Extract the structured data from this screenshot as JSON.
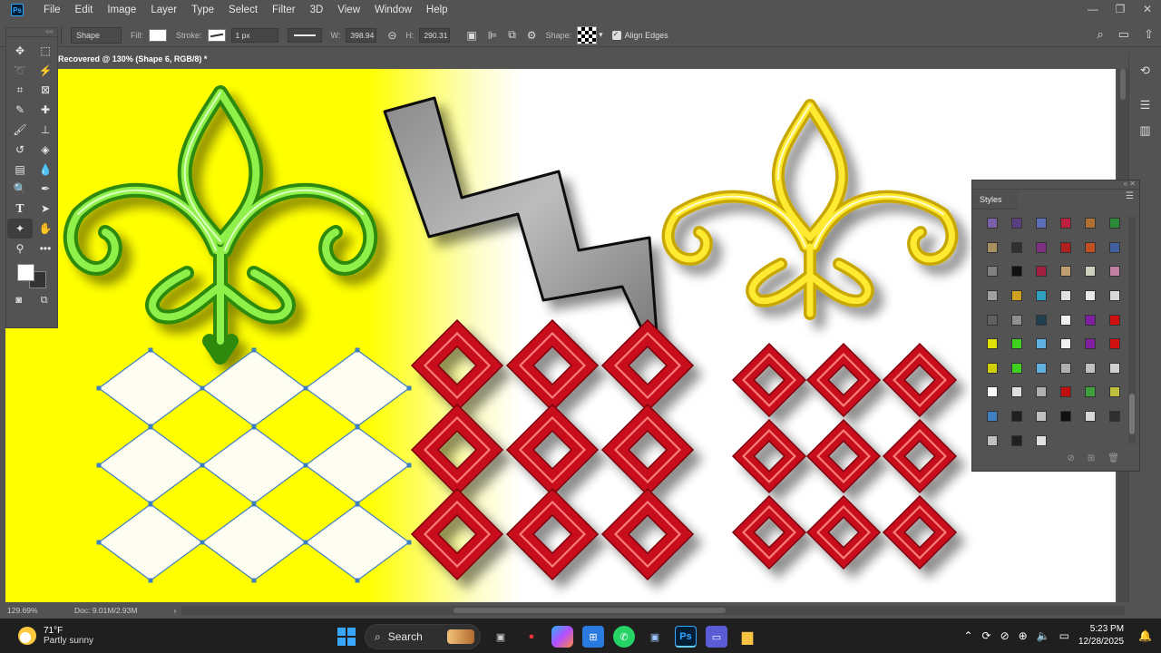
{
  "app": {
    "logo": "Ps"
  },
  "menu": [
    "File",
    "Edit",
    "Image",
    "Layer",
    "Type",
    "Select",
    "Filter",
    "3D",
    "View",
    "Window",
    "Help"
  ],
  "options_bar": {
    "tool_mode": "Shape",
    "fill_label": "Fill:",
    "stroke_label": "Stroke:",
    "stroke_width": "1 px",
    "w_label": "W:",
    "w_value": "398.94",
    "h_label": "H:",
    "h_value": "290.31",
    "shape_label": "Shape:",
    "align_edges": "Align Edges"
  },
  "document": {
    "tab_title": "Recovered @ 130% (Shape 6, RGB/8) *"
  },
  "styles_panel": {
    "title": "Styles",
    "swatches": [
      "#7b5fa8",
      "#5a3f80",
      "#5b6fb8",
      "#c02040",
      "#b07030",
      "#2a8a3a",
      "#a89060",
      "#303030",
      "#803080",
      "#b02020",
      "#c05020",
      "#4060a0",
      "#808080",
      "#101010",
      "#a02040",
      "#c0a070",
      "#d0d0c0",
      "#c080a0",
      "#a0a0a0",
      "#d0a020",
      "#30a0c0",
      "#e0e0e0",
      "#e8e8e8",
      "#d8d8d8",
      "#606060",
      "#909090",
      "#204050",
      "#f0f0f0",
      "#8020a0",
      "#d01010",
      "#e0e000",
      "#40d020",
      "#60b0e0",
      "#f0f0f0",
      "#8020a0",
      "#d01010",
      "#d0d000",
      "#40d020",
      "#60b0e0",
      "#b0b0b0",
      "#c0c0c0",
      "#d0d0d0",
      "#f8f8f8",
      "#e0e0e0",
      "#b0b0b0",
      "#c01010",
      "#40a040",
      "#c0c040",
      "#4080c0",
      "#202020",
      "#c0c0c0",
      "#101010",
      "#d8d8d8",
      "#303030",
      "#c0c0c0",
      "#202020",
      "#e0e0e0"
    ]
  },
  "status": {
    "zoom": "129.69%",
    "doc": "Doc: 9.01M/2.93M"
  },
  "taskbar": {
    "temp": "71°F",
    "weather": "Partly sunny",
    "search": "Search",
    "time": "5:23 PM",
    "date": "12/28/2025"
  }
}
